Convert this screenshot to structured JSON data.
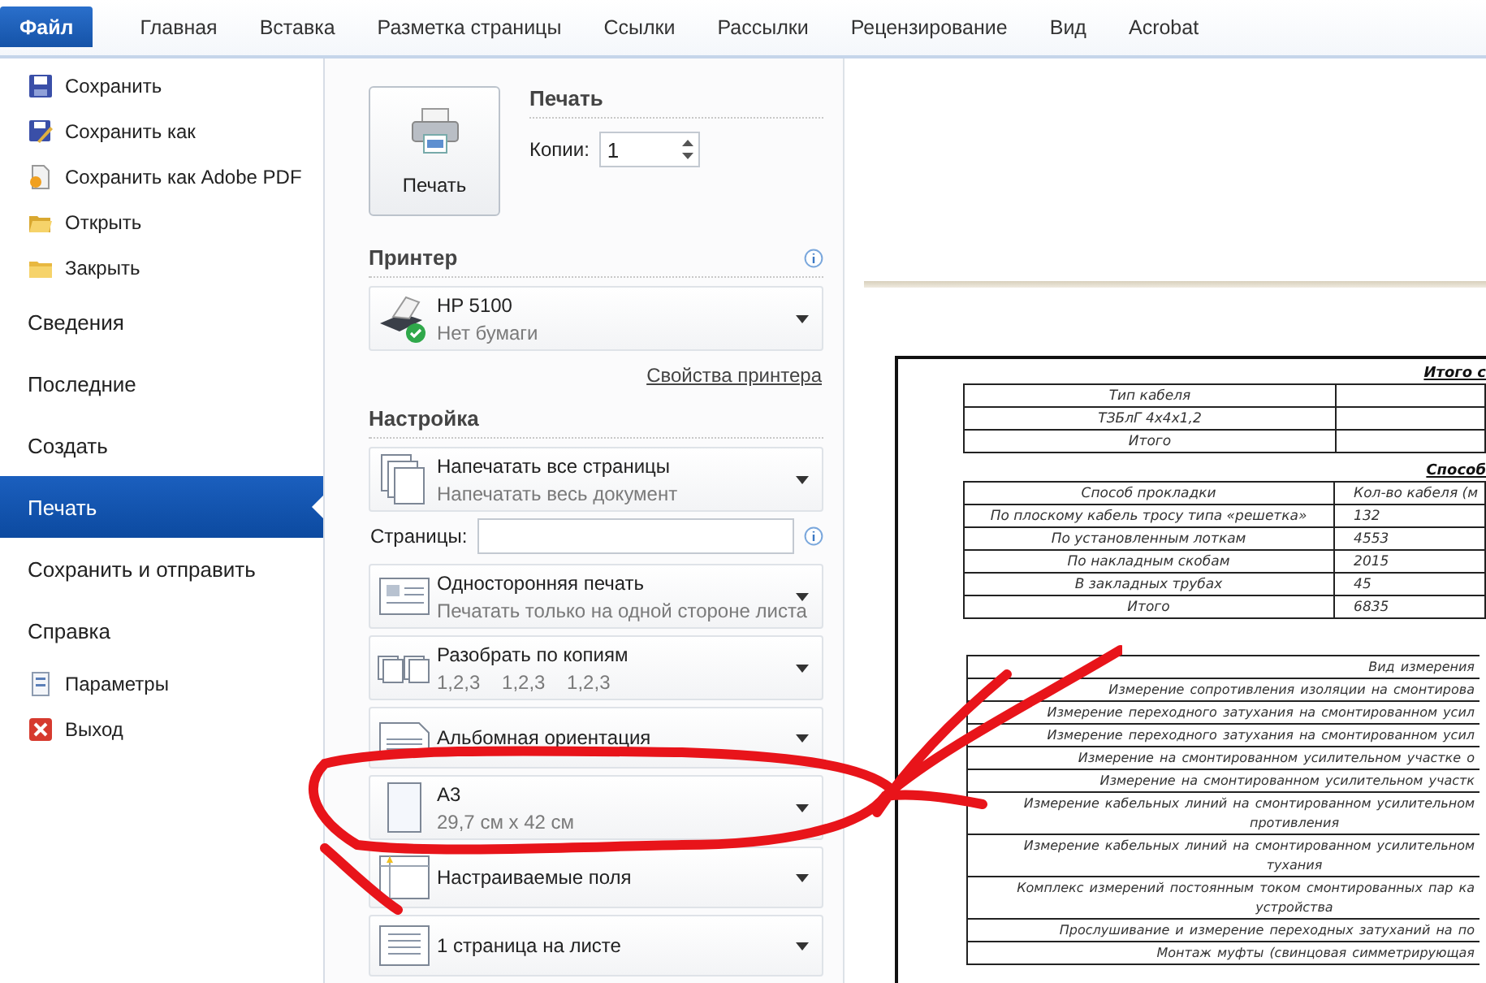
{
  "ribbon": {
    "tabs": [
      {
        "label": "Файл",
        "selected": true
      },
      {
        "label": "Главная",
        "selected": false
      },
      {
        "label": "Вставка",
        "selected": false
      },
      {
        "label": "Разметка страницы",
        "selected": false
      },
      {
        "label": "Ссылки",
        "selected": false
      },
      {
        "label": "Рассылки",
        "selected": false
      },
      {
        "label": "Рецензирование",
        "selected": false
      },
      {
        "label": "Вид",
        "selected": false
      },
      {
        "label": "Acrobat",
        "selected": false
      }
    ]
  },
  "sidebar": {
    "items": [
      {
        "kind": "save",
        "label": "Сохранить",
        "selected": false
      },
      {
        "kind": "saveas",
        "label": "Сохранить как",
        "selected": false
      },
      {
        "kind": "pdf",
        "label": "Сохранить как Adobe PDF",
        "selected": false
      },
      {
        "kind": "open",
        "label": "Открыть",
        "selected": false
      },
      {
        "kind": "close",
        "label": "Закрыть",
        "selected": false
      },
      {
        "kind": "section",
        "label": "Сведения",
        "selected": false
      },
      {
        "kind": "section",
        "label": "Последние",
        "selected": false
      },
      {
        "kind": "section",
        "label": "Создать",
        "selected": false
      },
      {
        "kind": "section",
        "label": "Печать",
        "selected": true
      },
      {
        "kind": "section",
        "label": "Сохранить и отправить",
        "selected": false
      },
      {
        "kind": "section",
        "label": "Справка",
        "selected": false
      },
      {
        "kind": "options",
        "label": "Параметры",
        "selected": false
      },
      {
        "kind": "exit",
        "label": "Выход",
        "selected": false
      }
    ]
  },
  "print": {
    "title": "Печать",
    "button": "Печать",
    "copies_label": "Копии:",
    "copies": "1"
  },
  "printer": {
    "title": "Принтер",
    "name": "HP 5100",
    "status": "Нет бумаги",
    "link": "Свойства принтера"
  },
  "settings": {
    "title": "Настройка",
    "items": [
      {
        "kind": "pages",
        "title": "Напечатать все страницы",
        "subtitle": "Напечатать весь документ"
      },
      {
        "kind": "range",
        "label": "Страницы:"
      },
      {
        "kind": "sides",
        "title": "Односторонняя печать",
        "subtitle": "Печатать только на одной стороне листа"
      },
      {
        "kind": "collate",
        "title": "Разобрать по копиям",
        "subtitle": "1,2,3    1,2,3    1,2,3"
      },
      {
        "kind": "orientation",
        "title": "Альбомная ориентация"
      },
      {
        "kind": "paper",
        "title": "A3",
        "subtitle": "29,7 см x 42 см"
      },
      {
        "kind": "margins",
        "title": "Настраиваемые поля"
      },
      {
        "kind": "persheet",
        "title": "1 страница на листе"
      }
    ]
  },
  "preview": {
    "title_1": "Итого с",
    "table_1": [
      [
        "Тип кабеля"
      ],
      [
        "ТЗБлГ 4х4х1,2"
      ],
      [
        "Итого"
      ]
    ],
    "title_2": "Способ",
    "table_2": [
      [
        "Способ прокладки",
        "Кол-во кабеля (м"
      ],
      [
        "По плоскому кабель тросу типа «решетка»",
        "132"
      ],
      [
        "По установленным лоткам",
        "4553"
      ],
      [
        "По накладным скобам",
        "2015"
      ],
      [
        "В закладных трубах",
        "45"
      ],
      [
        "Итого",
        "6835"
      ]
    ],
    "table_3": [
      [
        "Вид измерения"
      ],
      [
        "Измерение сопротивления изоляции на смонтирова"
      ],
      [
        "Измерение переходного затухания на смонтированном усил"
      ],
      [
        "Измерение переходного затухания на смонтированном усил"
      ],
      [
        "Измерение на смонтированном усилительном участке о"
      ],
      [
        "Измерение на смонтированном усилительном участк"
      ],
      [
        "Измерение кабельных линий на смонтированном усилительном",
        "противления"
      ],
      [
        "Измерение кабельных линий на смонтированном усилительном",
        "тухания"
      ],
      [
        "Комплекс измерений постоянным током смонтированных пар ка",
        "устройства"
      ],
      [
        "Прослушивание и измерение переходных затуханий на по"
      ],
      [
        "Монтаж муфты (свинцовая симметрирующая"
      ]
    ]
  }
}
